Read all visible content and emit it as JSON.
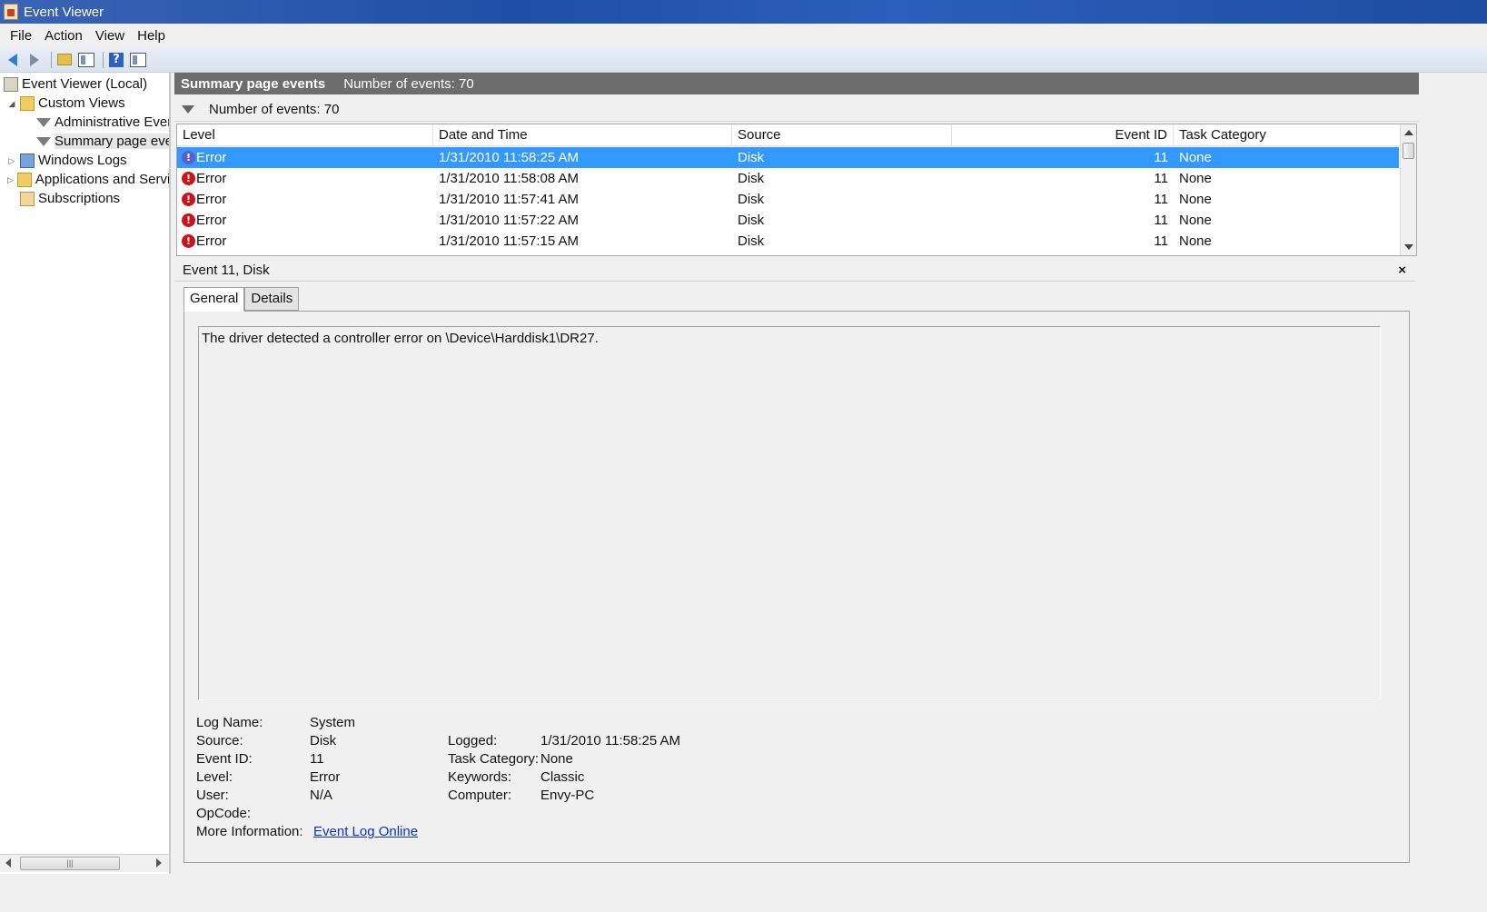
{
  "window": {
    "title": "Event Viewer"
  },
  "menu": [
    "File",
    "Action",
    "View",
    "Help"
  ],
  "toolbar": {
    "icons": [
      "back-icon",
      "forward-icon",
      "up-folder-icon",
      "show-hide-tree-icon",
      "help-icon",
      "show-hide-action-pane-icon"
    ]
  },
  "tree": {
    "root": "Event Viewer (Local)",
    "custom_views": "Custom Views",
    "admin_events": "Administrative Even",
    "summary_page": "Summary page ever",
    "windows_logs": "Windows Logs",
    "apps_services": "Applications and Servic",
    "subscriptions": "Subscriptions",
    "scroll_thumb": "|||"
  },
  "summary": {
    "title": "Summary page events",
    "count": "Number of events: 70"
  },
  "filter": {
    "count": "Number of events: 70"
  },
  "grid": {
    "columns": {
      "level": "Level",
      "datetime": "Date and Time",
      "source": "Source",
      "event_id": "Event ID",
      "task_category": "Task Category"
    },
    "rows": [
      {
        "level": "Error",
        "datetime": "1/31/2010 11:58:25 AM",
        "source": "Disk",
        "event_id": "11",
        "task_category": "None"
      },
      {
        "level": "Error",
        "datetime": "1/31/2010 11:58:08 AM",
        "source": "Disk",
        "event_id": "11",
        "task_category": "None"
      },
      {
        "level": "Error",
        "datetime": "1/31/2010 11:57:41 AM",
        "source": "Disk",
        "event_id": "11",
        "task_category": "None"
      },
      {
        "level": "Error",
        "datetime": "1/31/2010 11:57:22 AM",
        "source": "Disk",
        "event_id": "11",
        "task_category": "None"
      },
      {
        "level": "Error",
        "datetime": "1/31/2010 11:57:15 AM",
        "source": "Disk",
        "event_id": "11",
        "task_category": "None"
      }
    ]
  },
  "detail": {
    "title": "Event 11, Disk",
    "close": "×",
    "tabs": {
      "general": "General",
      "details": "Details"
    },
    "description": "The driver detected a controller error on \\Device\\Harddisk1\\DR27.",
    "labels": {
      "log_name": "Log Name:",
      "source": "Source:",
      "event_id": "Event ID:",
      "level": "Level:",
      "user": "User:",
      "opcode": "OpCode:",
      "more_info": "More Information:",
      "logged": "Logged:",
      "task_category": "Task Category:",
      "keywords": "Keywords:",
      "computer": "Computer:"
    },
    "values": {
      "log_name": "System",
      "source": "Disk",
      "event_id": "11",
      "level": "Error",
      "user": "N/A",
      "opcode": "",
      "more_info": "Event Log Online ",
      "logged": "1/31/2010 11:58:25 AM",
      "task_category": "None",
      "keywords": "Classic",
      "computer": "Envy-PC"
    }
  },
  "colors": {
    "selection": "#3399ff",
    "header_bar": "#6d6d6d",
    "error": "#c4161c",
    "link": "#0b33cc"
  }
}
